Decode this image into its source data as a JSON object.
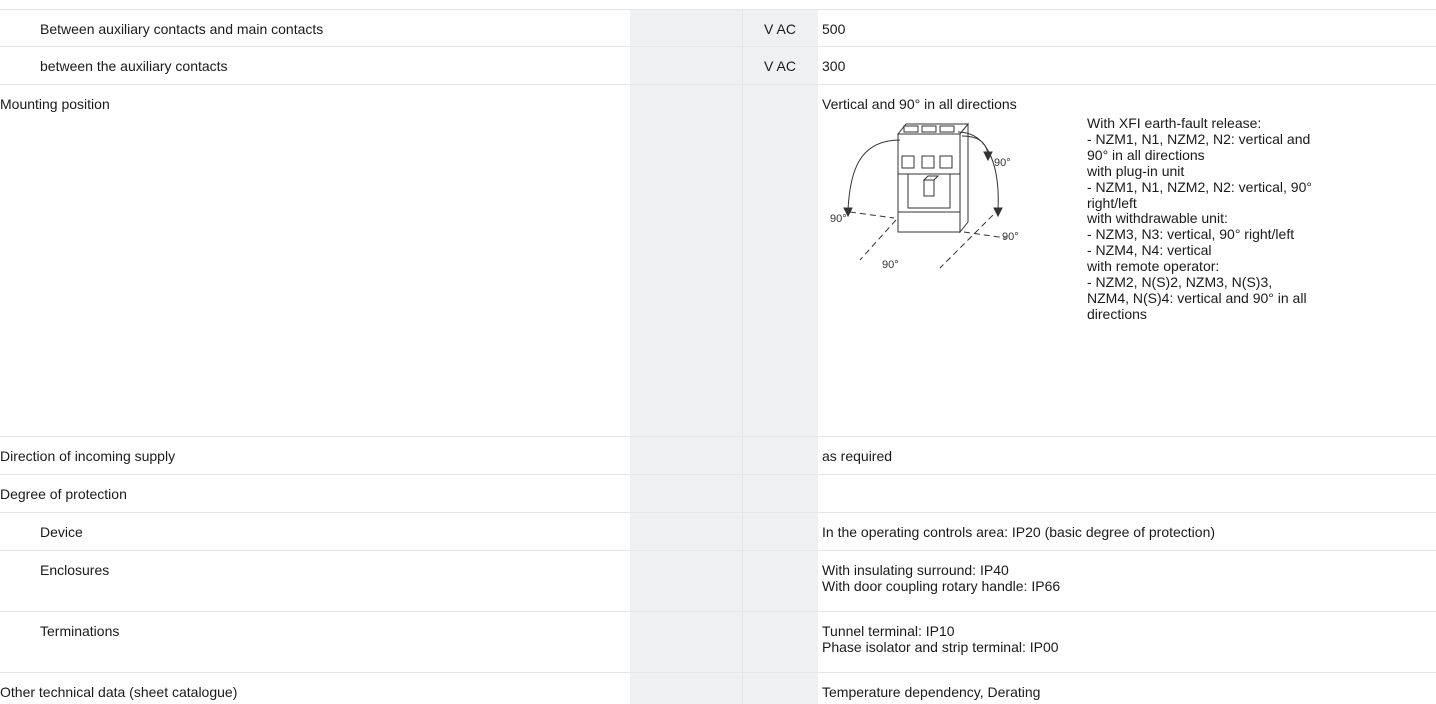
{
  "rows": [
    {
      "label": "Between auxiliary contacts and main contacts",
      "unit": "V AC",
      "value": [
        "500"
      ]
    },
    {
      "label": "between the auxiliary contacts",
      "unit": "V AC",
      "value": [
        "300"
      ]
    },
    {
      "label": "Mounting position",
      "unit": "",
      "value": [
        "Vertical and 90° in all directions"
      ]
    },
    {
      "label": "Direction of incoming supply",
      "unit": "",
      "value": [
        "as required"
      ]
    },
    {
      "label": "Degree of protection",
      "unit": "",
      "value": []
    },
    {
      "label": "Device",
      "unit": "",
      "value": [
        "In the operating controls area: IP20 (basic degree of protection)"
      ]
    },
    {
      "label": "Enclosures",
      "unit": "",
      "value": [
        "With insulating surround: IP40",
        "With door coupling rotary handle: IP66"
      ]
    },
    {
      "label": "Terminations",
      "unit": "",
      "value": [
        "Tunnel terminal: IP10",
        "Phase isolator and strip terminal: IP00"
      ]
    },
    {
      "label": "Other technical data (sheet catalogue)",
      "unit": "",
      "value": [
        "Temperature dependency, Derating"
      ]
    }
  ],
  "mounting_notes": [
    "With XFI earth-fault release:",
    "- NZM1, N1, NZM2, N2: vertical and",
    "90° in all directions",
    "with plug-in unit",
    "- NZM1, N1, NZM2, N2: vertical, 90°",
    "right/left",
    "with withdrawable unit:",
    "- NZM3, N3: vertical, 90° right/left",
    "- NZM4, N4: vertical",
    "with remote operator:",
    "- NZM2, N(S)2, NZM3, N(S)3,",
    "NZM4, N(S)4: vertical and 90° in all",
    "directions"
  ],
  "diagram_labels": {
    "top_right": "90°",
    "left": "90°",
    "right": "90°",
    "bottom": "90°"
  }
}
